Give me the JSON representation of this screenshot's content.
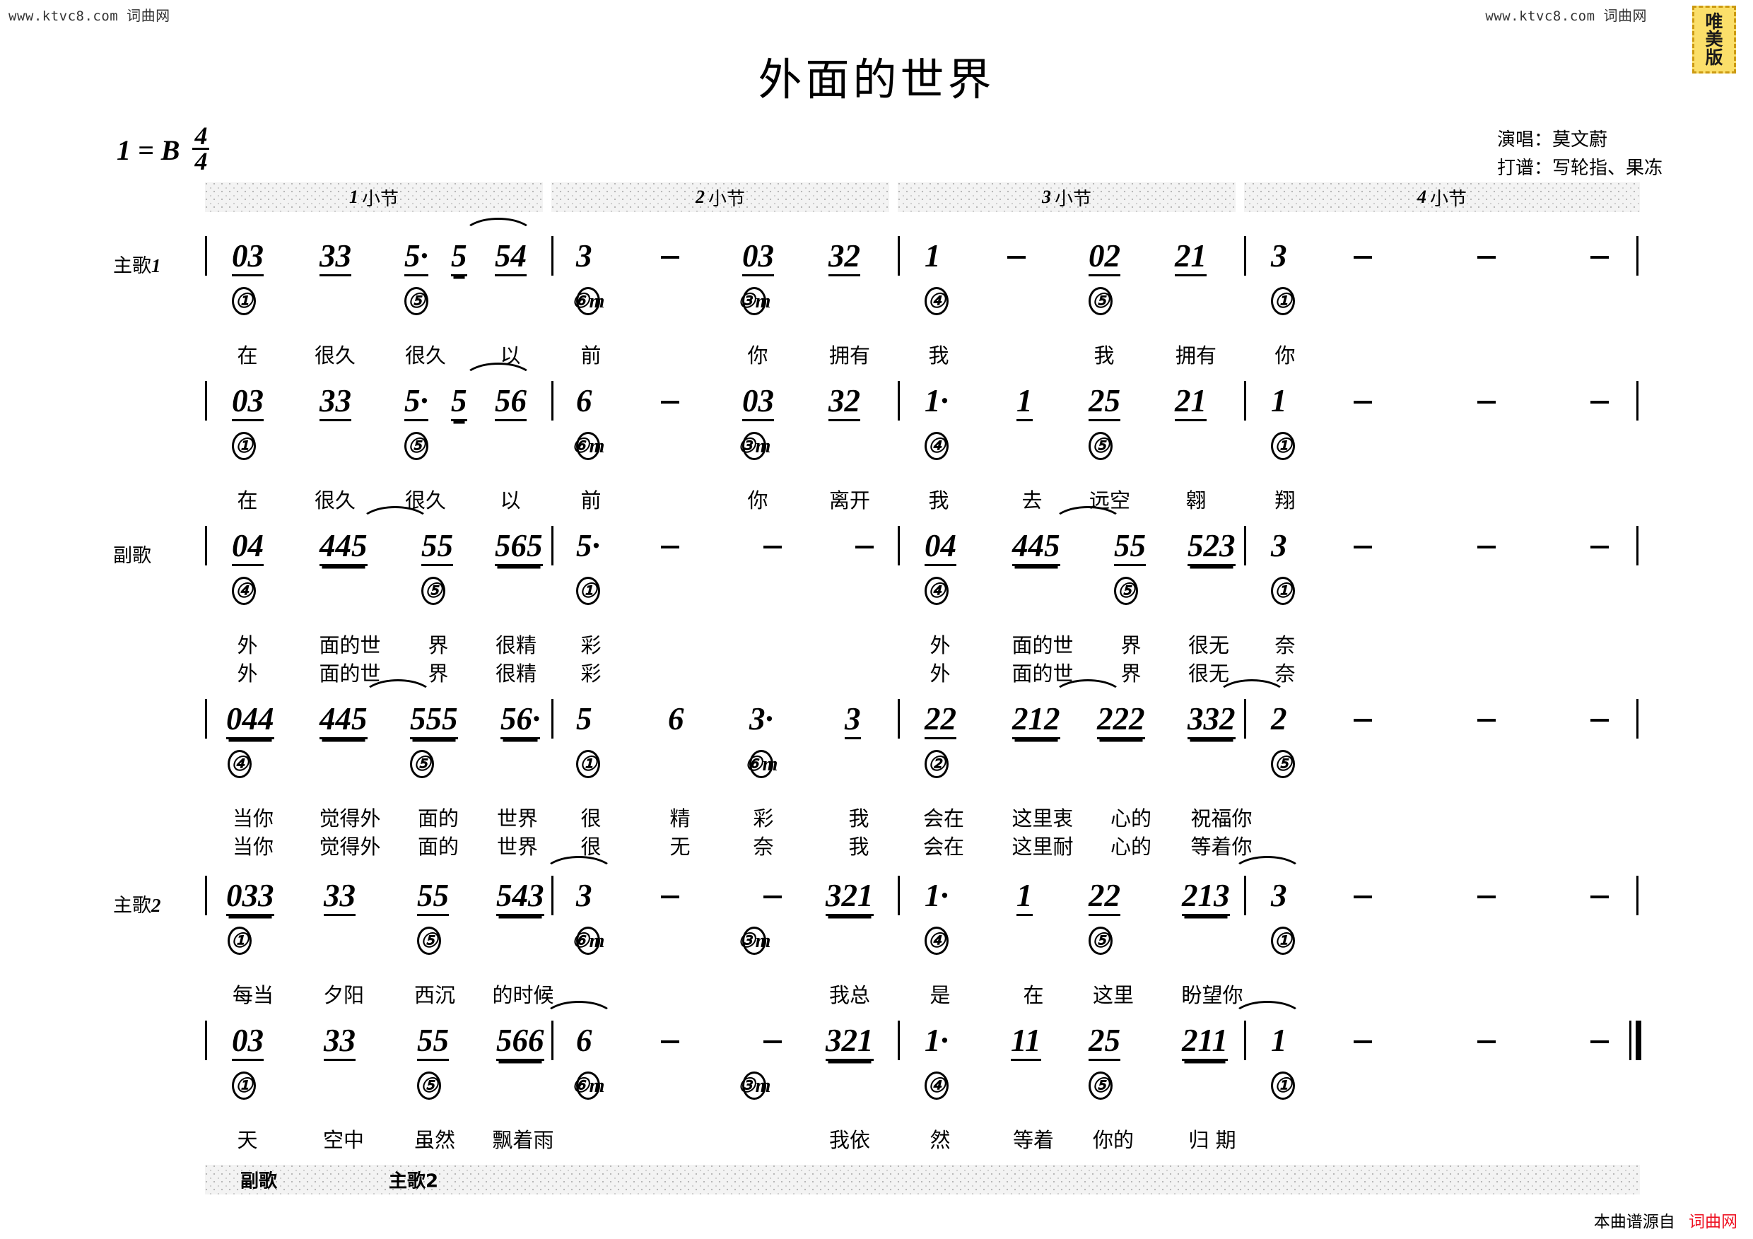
{
  "watermarks": {
    "top_left": "www.ktvc8.com",
    "top_left_cn": "词曲网",
    "top_right": "www.ktvc8.com",
    "top_right_cn": "词曲网",
    "stamp_lines": [
      "唯",
      "美",
      "版"
    ],
    "source_note": "本曲谱源自",
    "source_site": "词曲网"
  },
  "header": {
    "title": "外面的世界",
    "key": "1 = B",
    "meter_num": "4",
    "meter_den": "4",
    "credits": [
      "演唱：莫文蔚",
      "打谱：写轮指、果冻"
    ]
  },
  "measure_band": [
    {
      "num": "1",
      "label": "小节"
    },
    {
      "num": "2",
      "label": "小节"
    },
    {
      "num": "3",
      "label": "小节"
    },
    {
      "num": "4",
      "label": "小节"
    }
  ],
  "footer_band": [
    {
      "label": "副歌"
    },
    {
      "label": "主歌2"
    }
  ],
  "rows": [
    {
      "section": "主歌",
      "section_sup": "1",
      "notes": [
        "03",
        "33",
        "5·",
        "5",
        "54",
        "3",
        "—",
        "03",
        "32",
        "1",
        "—",
        "02",
        "21",
        "3",
        "—",
        "—",
        "—"
      ],
      "chords": [
        "①",
        "⑤",
        "⑥m",
        "③m",
        "④",
        "⑤",
        "①"
      ],
      "lyrics_lines": [
        [
          "在",
          "很久",
          "很久",
          "以",
          "前",
          "你",
          "拥有",
          "我",
          "我",
          "拥有",
          "你"
        ]
      ]
    },
    {
      "section": "",
      "section_sup": "",
      "notes": [
        "03",
        "33",
        "5·",
        "5",
        "56",
        "6",
        "—",
        "03",
        "32",
        "1·",
        "1",
        "25",
        "21",
        "1",
        "—",
        "—",
        "—"
      ],
      "chords": [
        "①",
        "⑤",
        "⑥m",
        "③m",
        "④",
        "⑤",
        "①"
      ],
      "lyrics_lines": [
        [
          "在",
          "很久",
          "很久",
          "以",
          "前",
          "你",
          "离开",
          "我",
          "去",
          "远空",
          "翱",
          "翔"
        ]
      ]
    },
    {
      "section": "副歌",
      "section_sup": "",
      "notes": [
        "04",
        "445",
        "55",
        "565",
        "5·",
        "—",
        "—",
        "—",
        "04",
        "445",
        "55",
        "523",
        "3",
        "—",
        "—",
        "—"
      ],
      "chords": [
        "④",
        "⑤",
        "①",
        "④",
        "⑤",
        "①"
      ],
      "lyrics_lines": [
        [
          "外",
          "面的世",
          "界",
          "很精",
          "彩",
          "外",
          "面的世",
          "界",
          "很无",
          "奈"
        ],
        [
          "外",
          "面的世",
          "界",
          "很精",
          "彩",
          "外",
          "面的世",
          "界",
          "很无",
          "奈"
        ]
      ]
    },
    {
      "section": "",
      "section_sup": "",
      "notes": [
        "044",
        "445",
        "555",
        "56·",
        "5",
        "6",
        "3·",
        "3",
        "22",
        "212",
        "222",
        "332",
        "2",
        "—",
        "—",
        "—"
      ],
      "chords": [
        "④",
        "⑤",
        "①",
        "⑥m",
        "②",
        "⑤"
      ],
      "lyrics_lines": [
        [
          "当你",
          "觉得外",
          "面的",
          "世界",
          "很",
          "精",
          "彩",
          "我",
          "会在",
          "这里衷",
          "心的",
          "祝福你"
        ],
        [
          "当你",
          "觉得外",
          "面的",
          "世界",
          "很",
          "无",
          "奈",
          "我",
          "会在",
          "这里耐",
          "心的",
          "等着你"
        ]
      ]
    },
    {
      "section": "主歌",
      "section_sup": "2",
      "notes": [
        "033",
        "33",
        "55",
        "543",
        "3",
        "—",
        "—",
        "321",
        "1·",
        "1",
        "22",
        "213",
        "3",
        "—",
        "—",
        "—"
      ],
      "chords": [
        "①",
        "⑤",
        "⑥m",
        "③m",
        "④",
        "⑤",
        "①"
      ],
      "lyrics_lines": [
        [
          "每当",
          "夕阳",
          "西沉",
          "的时候",
          "我总",
          "是",
          "在",
          "这里",
          "盼望你"
        ]
      ]
    },
    {
      "section": "",
      "section_sup": "",
      "notes": [
        "03",
        "33",
        "55",
        "566",
        "6",
        "—",
        "—",
        "321",
        "1·",
        "11",
        "25",
        "211",
        "1",
        "—",
        "—",
        "—"
      ],
      "chords": [
        "①",
        "⑤",
        "⑥m",
        "③m",
        "④",
        "⑤",
        "①"
      ],
      "lyrics_lines": [
        [
          "天",
          "空中",
          "虽然",
          "飘着雨",
          "我依",
          "然",
          "等着",
          "你的",
          "归  期"
        ]
      ]
    }
  ]
}
